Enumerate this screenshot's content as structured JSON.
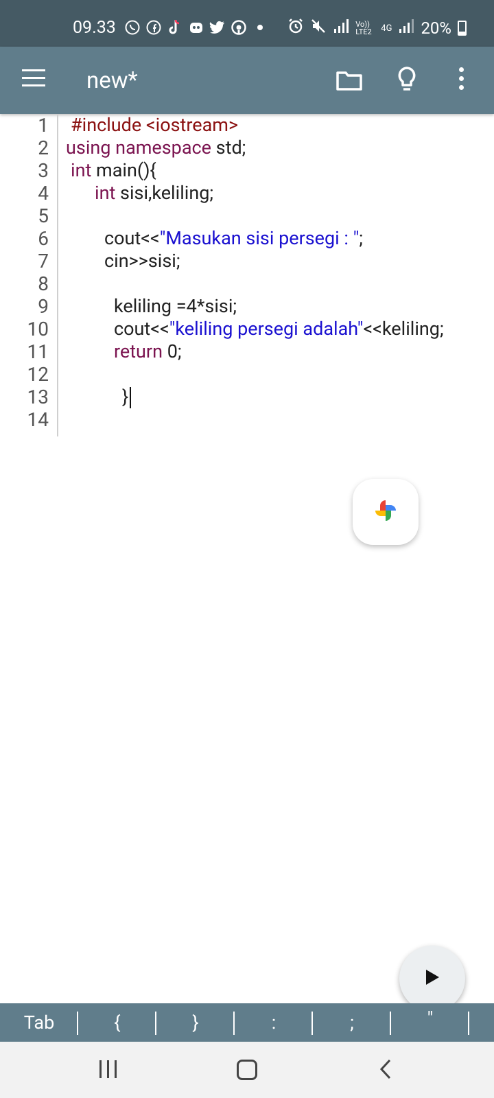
{
  "status_bar": {
    "time": "09.33",
    "left_icons": [
      "whatsapp-icon",
      "facebook-icon",
      "tiktok-icon",
      "dating-app-icon",
      "twitter-icon",
      "assistant-icon",
      "dot-icon"
    ],
    "right_icons": [
      "alarm-icon",
      "mute-icon",
      "signal-icon",
      "volte-icon",
      "network-4g-icon",
      "signal-icon-2"
    ],
    "volte_label": "Vo)) LTE2",
    "network_label": "4G",
    "battery_text": "20%"
  },
  "toolbar": {
    "title": "new*",
    "icons": [
      "menu-icon",
      "folder-icon",
      "lightbulb-icon",
      "more-vert-icon"
    ]
  },
  "editor": {
    "line_numbers": [
      "1",
      "2",
      "3",
      "4",
      "5",
      "6",
      "7",
      "8",
      "9",
      "10",
      "11",
      "12",
      "13",
      "14"
    ],
    "line1": {
      "text": "#include <iostream>"
    },
    "line2": {
      "kw": "using namespace",
      "rest": " std;"
    },
    "line3": {
      "kw": "int",
      "rest": " main(){"
    },
    "line4": {
      "kw": "int",
      "rest": " sisi,keliling;"
    },
    "line6": {
      "pre": "cout<<",
      "str": "\"Masukan sisi persegi : \"",
      "post": ";"
    },
    "line7": {
      "text": "cin>>sisi;"
    },
    "line9": {
      "text": "keliling =4*sisi;"
    },
    "line10": {
      "pre": "cout<<",
      "str": "\"keliling persegi adalah\"",
      "post": "<<keliling;"
    },
    "line11": {
      "kw": "return",
      "rest": " 0;"
    },
    "line13": {
      "text": "}"
    }
  },
  "floating": {
    "photos_icon": "google-photos-pinwheel-icon",
    "run_icon": "play-icon"
  },
  "keybar": {
    "keys": [
      "Tab",
      "{",
      "}",
      ":",
      ";",
      "\""
    ]
  },
  "navbar": {
    "icons": [
      "recent-apps-icon",
      "home-icon",
      "back-icon"
    ]
  },
  "colors": {
    "status_bar": "#455a64",
    "toolbar": "#607d8b",
    "keyword": "#7b1450",
    "preprocessor": "#8b1111",
    "string": "#1a10d0"
  }
}
